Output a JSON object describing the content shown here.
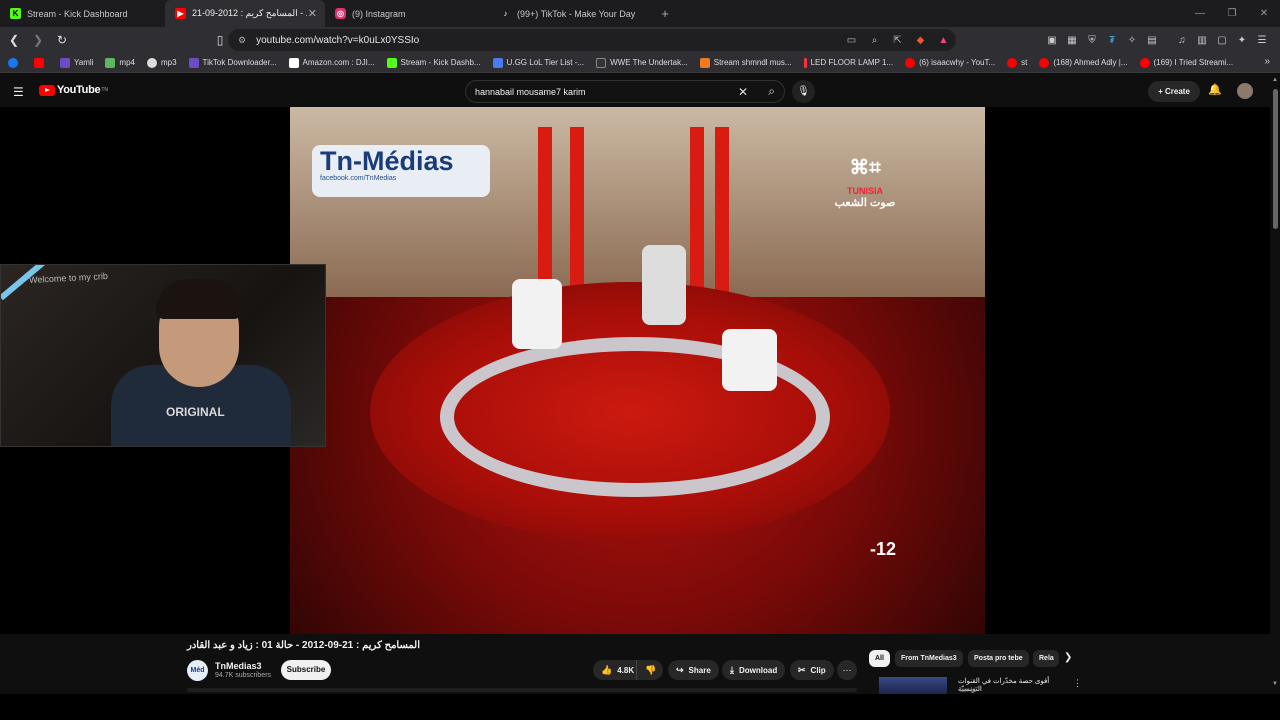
{
  "tabs": [
    {
      "title": "Stream - Kick Dashboard",
      "icon": "kick-icon",
      "color": "#53fc18",
      "active": false
    },
    {
      "title": "المسامح كريم : 2012-09-21 - ...",
      "icon": "youtube-icon",
      "color": "#ff0000",
      "active": true
    },
    {
      "title": "(9) Instagram",
      "icon": "instagram-icon",
      "color": "#e1306c",
      "active": false
    },
    {
      "title": "(99+) TikTok - Make Your Day",
      "icon": "tiktok-icon",
      "color": "#ffffff",
      "active": false
    }
  ],
  "address": {
    "url": "youtube.com/watch?v=k0uLx0YSSIo"
  },
  "bookmarks": [
    {
      "label": "Yamli",
      "color": "#6b4cc2"
    },
    {
      "label": "mp4",
      "color": "#5cb85c"
    },
    {
      "label": "mp3",
      "color": "#dddddd"
    },
    {
      "label": "TikTok Downloader...",
      "color": "#6b4cc2"
    },
    {
      "label": "Amazon.com : DJI...",
      "color": "#ffffff"
    },
    {
      "label": "Stream - Kick Dashb...",
      "color": "#53fc18"
    },
    {
      "label": "U.GG LoL Tier List -...",
      "color": "#4a7cf0"
    },
    {
      "label": "WWE The Undertak...",
      "color": "#333333"
    },
    {
      "label": "Stream shmndl mus...",
      "color": "#f07a20"
    },
    {
      "label": "LED FLOOR LAMP 1...",
      "color": "#ff3040"
    },
    {
      "label": "(6) isaacwhy - YouT...",
      "color": "#ff0000"
    },
    {
      "label": "st",
      "color": "#ff0000"
    },
    {
      "label": "(168) Ahmed Adly |...",
      "color": "#ff0000"
    },
    {
      "label": "(169) I Tried Streami...",
      "color": "#ff0000"
    }
  ],
  "youtube": {
    "logo": "YouTube",
    "logo_sup": "TN",
    "search_value": "hannabail mousame7 karim",
    "create_label": "Create"
  },
  "video": {
    "overlay_logo": "Tn-Médias",
    "overlay_logo_sub": "facebook.com/TnMedias",
    "channel_logo_sub": "TUNISIA",
    "channel_logo_tagline": "صوت الشعب",
    "counter": "-12",
    "webcam_sign": "Welcome to my crib",
    "webcam_shirt": "ORIGINAL"
  },
  "meta": {
    "title": "المسامح كريم : 21-09-2012 - حالة 01 : زياد و عبد القادر",
    "channel_name": "TnMedias3",
    "channel_avatar": "Méd",
    "subscribers": "94.7K subscribers",
    "subscribe_label": "Subscribe",
    "likes": "4.8K",
    "share_label": "Share",
    "download_label": "Download",
    "clip_label": "Clip"
  },
  "chips": [
    "All",
    "From TnMedias3",
    "Posta pro tebe",
    "Rela"
  ],
  "related": {
    "title": "أقوى حصة مخدّرات في القنوات التونسيّة",
    "sub": "tan 10"
  }
}
